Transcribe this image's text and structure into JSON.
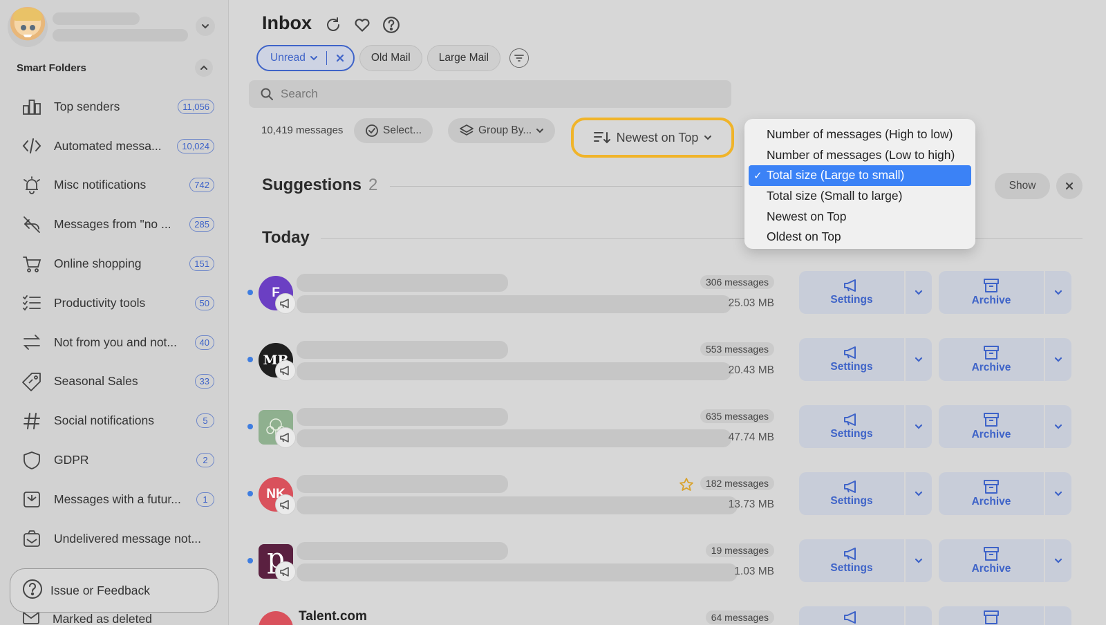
{
  "sidebar": {
    "smart_folders_title": "Smart Folders",
    "items": [
      {
        "label": "Top senders",
        "badge": "11,056",
        "icon": "bar-chart-icon"
      },
      {
        "label": "Automated messa...",
        "badge": "10,024",
        "icon": "code-icon"
      },
      {
        "label": "Misc notifications",
        "badge": "742",
        "icon": "alarm-bell-icon"
      },
      {
        "label": "Messages from \"no ...",
        "badge": "285",
        "icon": "no-reply-icon"
      },
      {
        "label": "Online shopping",
        "badge": "151",
        "icon": "shopping-cart-icon"
      },
      {
        "label": "Productivity tools",
        "badge": "50",
        "icon": "checklist-icon"
      },
      {
        "label": "Not from you and not...",
        "badge": "40",
        "icon": "swap-arrows-icon"
      },
      {
        "label": "Seasonal Sales",
        "badge": "33",
        "icon": "price-tag-icon"
      },
      {
        "label": "Social notifications",
        "badge": "5",
        "icon": "hashtag-icon"
      },
      {
        "label": "GDPR",
        "badge": "2",
        "icon": "shield-icon"
      },
      {
        "label": "Messages with a futur...",
        "badge": "1",
        "icon": "scheduled-icon"
      },
      {
        "label": "Undelivered message not...",
        "badge": "",
        "icon": "undelivered-icon"
      }
    ],
    "feedback_label": "Issue or Feedback",
    "marked_deleted_label": "Marked as deleted"
  },
  "header": {
    "title": "Inbox"
  },
  "filters": {
    "unread": "Unread",
    "old_mail": "Old Mail",
    "large_mail": "Large Mail"
  },
  "search": {
    "placeholder": "Search"
  },
  "toolbar": {
    "message_count": "10,419 messages",
    "select": "Select...",
    "group_by": "Group By...",
    "sort": "Newest on Top"
  },
  "sort_menu": {
    "options": [
      "Number of messages (High to low)",
      "Number of messages (Low to high)",
      "Total size (Large to small)",
      "Total size (Small to large)",
      "Newest on Top",
      "Oldest on Top"
    ],
    "selected": "Total size (Large to small)",
    "check": "✓"
  },
  "suggestions": {
    "title": "Suggestions",
    "count": "2",
    "show": "Show"
  },
  "today": {
    "title": "Today"
  },
  "rows": [
    {
      "initials": "F",
      "avatar_color": "#6b3fc3",
      "count": "306 messages",
      "size": "25.03 MB",
      "sender": ""
    },
    {
      "initials": "MB",
      "avatar_color": "#1f1f1f",
      "count": "553 messages",
      "size": "20.43 MB",
      "sender": ""
    },
    {
      "initials": "",
      "avatar_color": "#8fb08f",
      "count": "635 messages",
      "size": "47.74 MB",
      "sender": ""
    },
    {
      "initials": "NK",
      "avatar_color": "#d9515c",
      "count": "182 messages",
      "size": "13.73 MB",
      "sender": ""
    },
    {
      "initials": "p",
      "avatar_color": "#5a2040",
      "count": "19 messages",
      "size": "1.03 MB",
      "sender": ""
    },
    {
      "initials": "",
      "avatar_color": "#d9515c",
      "count": "64 messages",
      "size": "",
      "sender": "Talent.com"
    }
  ],
  "row_buttons": {
    "settings": "Settings",
    "archive": "Archive"
  },
  "colors": {
    "accent": "#3e63c8",
    "sort_highlight": "#f0b42a",
    "menu_selected": "#3b82f6"
  }
}
